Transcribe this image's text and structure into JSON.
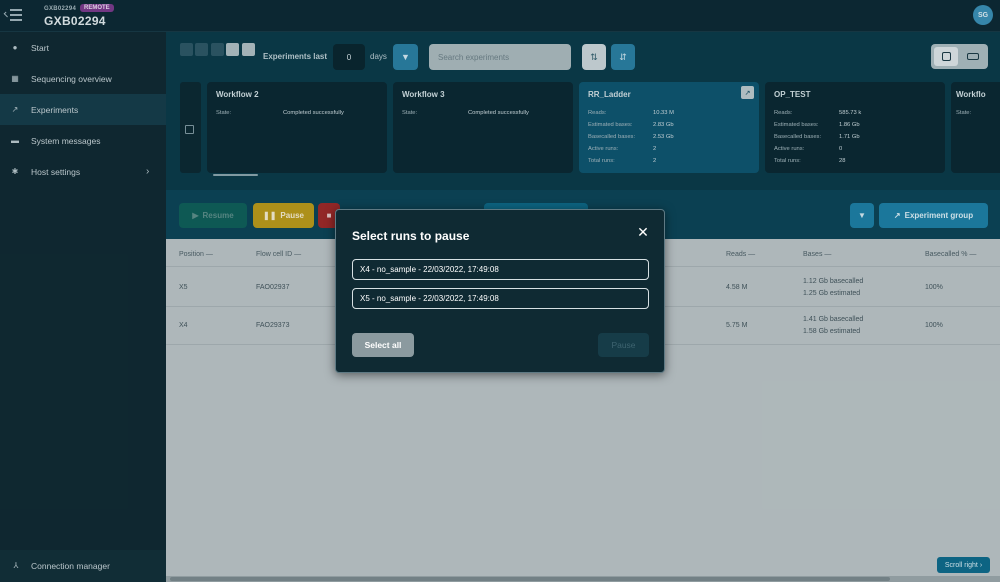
{
  "topbar": {
    "device_id": "GXB02294",
    "remote_badge": "REMOTE",
    "device_name": "GXB02294",
    "avatar_initials": "SG"
  },
  "sidebar": {
    "items": [
      {
        "label": "Start",
        "icon": "play-circle-icon"
      },
      {
        "label": "Sequencing overview",
        "icon": "grid-icon"
      },
      {
        "label": "Experiments",
        "icon": "trend-line-icon",
        "active": true
      },
      {
        "label": "System messages",
        "icon": "message-icon"
      },
      {
        "label": "Host settings",
        "icon": "gear-icon"
      }
    ],
    "connection_manager": "Connection manager"
  },
  "toolbar": {
    "experiments_last_label": "Experiments last",
    "days_value": "0",
    "days_label": "days",
    "search_placeholder": "Search experiments"
  },
  "workflows": [
    {
      "title": "Workflow 2",
      "state_label": "State:",
      "state_value": "Completed successfully"
    },
    {
      "title": "Workflow 3",
      "state_label": "State:",
      "state_value": "Completed successfully"
    },
    {
      "title": "RR_Ladder",
      "rows": [
        {
          "label": "Reads:",
          "value": "10.33 M"
        },
        {
          "label": "Estimated bases:",
          "value": "2.83 Gb"
        },
        {
          "label": "Basecalled bases:",
          "value": "2.53 Gb"
        },
        {
          "label": "Active runs:",
          "value": "2"
        },
        {
          "label": "Total runs:",
          "value": "2"
        }
      ]
    },
    {
      "title": "OP_TEST",
      "rows": [
        {
          "label": "Reads:",
          "value": "585.73 k"
        },
        {
          "label": "Estimated bases:",
          "value": "1.86 Gb"
        },
        {
          "label": "Basecalled bases:",
          "value": "1.71 Gb"
        },
        {
          "label": "Active runs:",
          "value": "0"
        },
        {
          "label": "Total runs:",
          "value": "28"
        }
      ]
    },
    {
      "title": "Workflo",
      "state_label": "State:"
    }
  ],
  "actions": {
    "resume": "Resume",
    "pause": "Pause",
    "stop": "Stop",
    "experiment_group": "Experiment group"
  },
  "table": {
    "headers": {
      "position": "Position",
      "flow_cell": "Flow cell ID",
      "reads": "Reads",
      "bases": "Bases",
      "basecalled": "Basecalled %"
    },
    "rows": [
      {
        "position": "X5",
        "flow_cell": "FAO02937",
        "reads": "4.58 M",
        "bases_1": "1.12 Gb basecalled",
        "bases_2": "1.25 Gb estimated",
        "basecalled": "100%"
      },
      {
        "position": "X4",
        "flow_cell": "FAO29373",
        "reads": "5.75 M",
        "bases_1": "1.41 Gb basecalled",
        "bases_2": "1.58 Gb estimated",
        "basecalled": "100%"
      }
    ],
    "scroll_right": "Scroll right"
  },
  "modal": {
    "title": "Select runs to pause",
    "options": [
      "X4 - no_sample - 22/03/2022, 17:49:08",
      "X5 - no_sample - 22/03/2022, 17:49:08"
    ],
    "select_all": "Select all",
    "pause": "Pause"
  }
}
